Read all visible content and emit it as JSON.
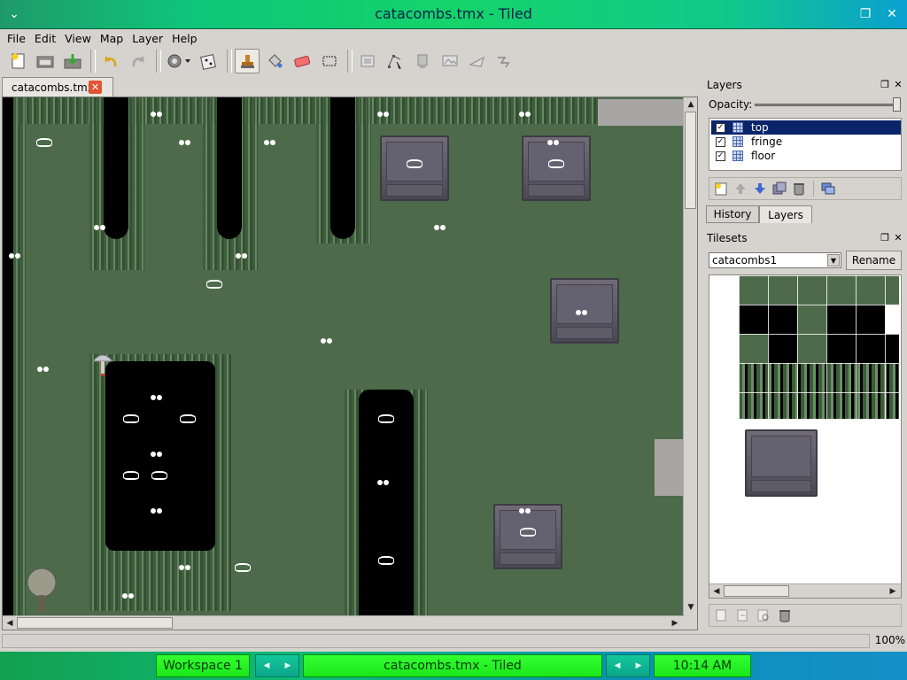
{
  "window": {
    "title": "catacombs.tmx - Tiled",
    "menu_icon": "chevron-down-icon",
    "restore_icon": "restore-icon",
    "close_icon": "close-icon"
  },
  "menubar": {
    "items": [
      "File",
      "Edit",
      "View",
      "Map",
      "Layer",
      "Help"
    ]
  },
  "toolbar": {
    "buttons": [
      "new-map-icon",
      "open-icon",
      "save-icon",
      "undo-icon",
      "redo-icon",
      "commands-icon",
      "random-icon",
      "stamp-brush-icon",
      "bucket-fill-icon",
      "eraser-icon",
      "rectangle-select-icon",
      "insert-object-icon",
      "edit-polygon-icon",
      "insert-tile-icon",
      "insert-image-icon",
      "insert-polygon-icon",
      "insert-polyline-icon"
    ]
  },
  "document": {
    "tab_label": "catacombs.tmx"
  },
  "layers_panel": {
    "title": "Layers",
    "opacity_label": "Opacity:",
    "opacity": 1.0,
    "layers": [
      {
        "name": "top",
        "visible": true,
        "selected": true
      },
      {
        "name": "fringe",
        "visible": true,
        "selected": false
      },
      {
        "name": "floor",
        "visible": true,
        "selected": false
      }
    ],
    "tabs": [
      "History",
      "Layers"
    ],
    "active_tab": "Layers"
  },
  "tilesets_panel": {
    "title": "Tilesets",
    "selected_tileset": "catacombs1",
    "rename_label": "Rename"
  },
  "statusbar": {
    "zoom": "100%"
  },
  "taskbar": {
    "workspace": "Workspace 1",
    "window_title": "catacombs.tmx - Tiled",
    "clock": "10:14 AM"
  },
  "colors": {
    "grass": "#4d6b4a",
    "selection": "#0a246a",
    "taskbar_green": "#33ff33"
  }
}
